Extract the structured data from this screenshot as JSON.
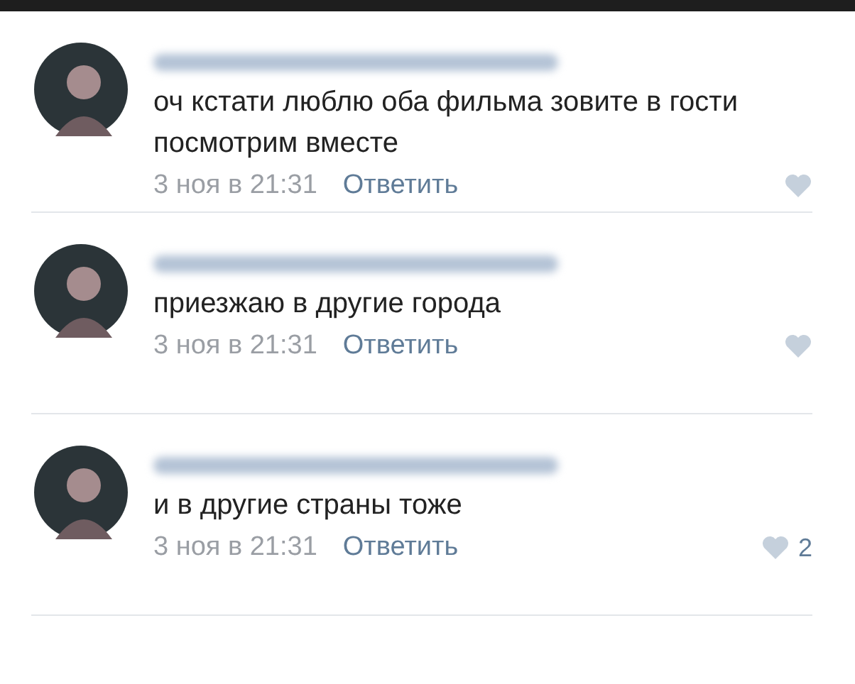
{
  "comments": [
    {
      "text": "оч кстати люблю оба фильма зовите в гости посмотрим вместе",
      "date": "3 ноя в 21:31",
      "reply": "Ответить"
    },
    {
      "text": "приезжаю в другие города",
      "date": "3 ноя в 21:31",
      "reply": "Ответить"
    },
    {
      "text": "и в другие страны тоже",
      "date": "3 ноя в 21:31",
      "reply": "Ответить",
      "likes": "2"
    }
  ]
}
